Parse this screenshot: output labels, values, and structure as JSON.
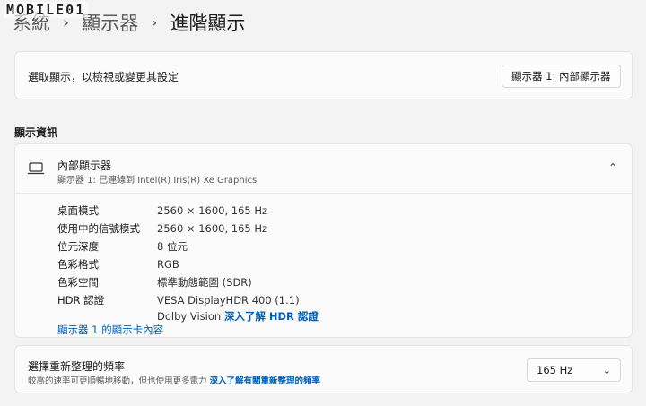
{
  "watermark": "MOBILE01",
  "breadcrumb": {
    "crumb1": "系統",
    "crumb2": "顯示器",
    "current": "進階顯示",
    "separator": "›"
  },
  "select_display": {
    "label": "選取顯示，以檢視或變更其設定",
    "dropdown_value": "顯示器 1: 內部顯示器"
  },
  "display_info": {
    "section_title": "顯示資訊",
    "monitor_name": "內部顯示器",
    "monitor_sub": "顯示器 1: 已連線到 Intel(R) Iris(R) Xe Graphics",
    "rows": [
      {
        "key": "桌面模式",
        "value": "2560 × 1600, 165 Hz"
      },
      {
        "key": "使用中的信號模式",
        "value": "2560 × 1600, 165 Hz"
      },
      {
        "key": "位元深度",
        "value": "8 位元"
      },
      {
        "key": "色彩格式",
        "value": "RGB"
      },
      {
        "key": "色彩空間",
        "value": "標準動態範圍 (SDR)"
      },
      {
        "key": "HDR 認證",
        "value": "VESA DisplayHDR 400 (1.1)"
      }
    ],
    "hdr_cont_text": "Dolby Vision",
    "hdr_link": "深入了解 HDR 認證",
    "adapter_link": "顯示器 1 的顯示卡內容"
  },
  "refresh": {
    "title": "選擇重新整理的頻率",
    "subtitle": "較高的速率可更順暢地移動，但也使用更多電力",
    "link": "深入了解有關重新整理的頻率",
    "dropdown_value": "165 Hz"
  },
  "icons": {
    "chevron_down": "chevron-down-icon",
    "chevron_up": "chevron-up-icon",
    "monitor": "monitor-icon"
  },
  "colors": {
    "accent_link": "#005fb8",
    "background": "#f3f3f3",
    "card": "#fbfbfb"
  }
}
